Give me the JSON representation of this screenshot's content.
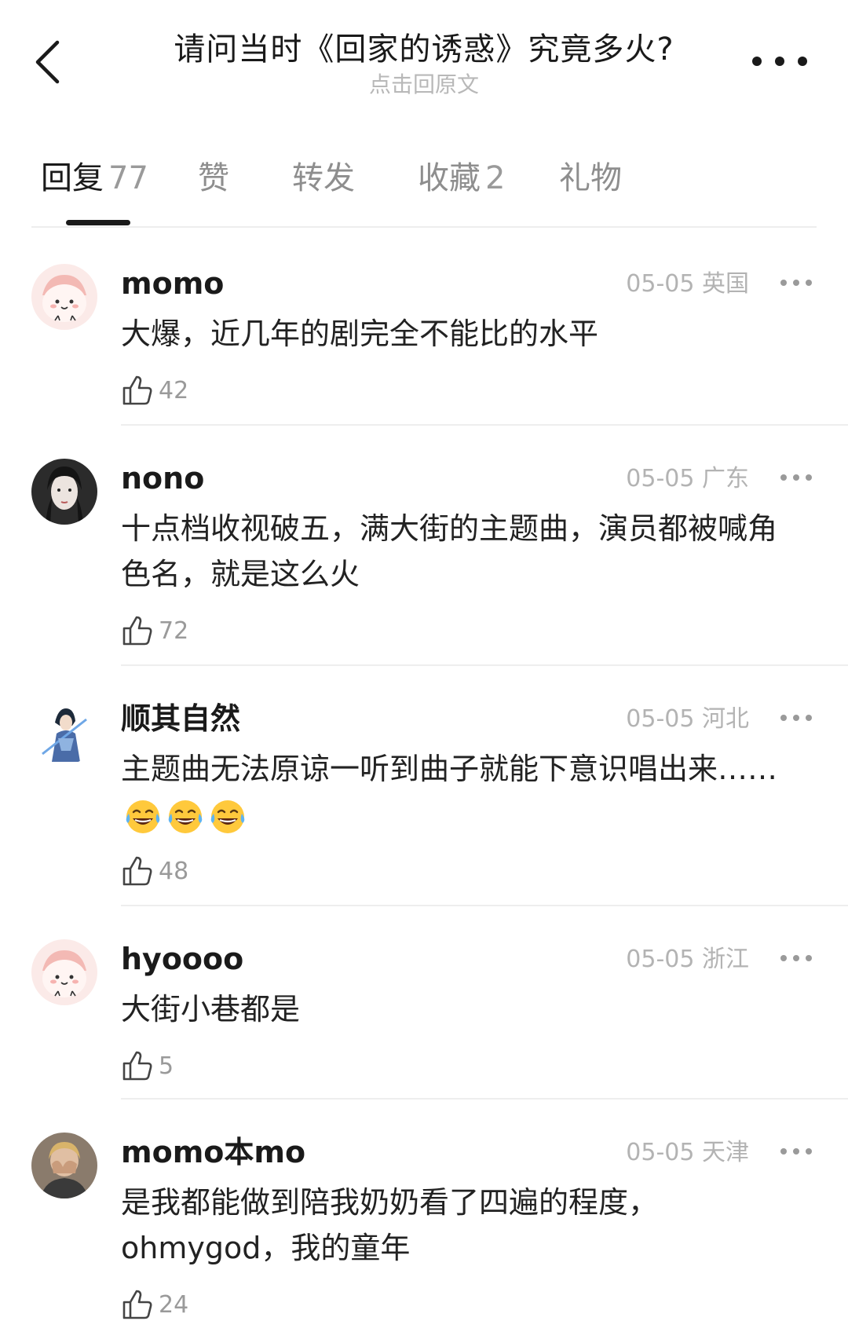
{
  "header": {
    "title": "请问当时《回家的诱惑》究竟多火?",
    "subtitle": "点击回原文"
  },
  "tabs": [
    {
      "label": "回复",
      "count": "77"
    },
    {
      "label": "赞",
      "count": ""
    },
    {
      "label": "转发",
      "count": ""
    },
    {
      "label": "收藏",
      "count": "2"
    },
    {
      "label": "礼物",
      "count": ""
    }
  ],
  "comments": [
    {
      "username": "momo",
      "date": "05-05",
      "location": "英国",
      "text": "大爆，近几年的剧完全不能比的水平",
      "likes": "42",
      "avatar": "cartoon-avatar"
    },
    {
      "username": "nono",
      "date": "05-05",
      "location": "广东",
      "text": "十点档收视破五，满大街的主题曲，演员都被喊角色名，就是这么火",
      "likes": "72",
      "avatar": "portrait-avatar"
    },
    {
      "username": "顺其自然",
      "date": "05-05",
      "location": "河北",
      "text": "主题曲无法原谅一听到曲子就能下意识唱出来……",
      "emoji": "laughing-tears-emoji",
      "emoji_count": 3,
      "likes": "48",
      "avatar": "anime-warrior-avatar"
    },
    {
      "username": "hyoooo",
      "date": "05-05",
      "location": "浙江",
      "text": "大街小巷都是",
      "likes": "5",
      "avatar": "cartoon-avatar"
    },
    {
      "username": "momo本mo",
      "date": "05-05",
      "location": "天津",
      "text": "是我都能做到陪我奶奶看了四遍的程度，ohmygod，我的童年",
      "likes": "24",
      "avatar": "photo-avatar"
    }
  ]
}
